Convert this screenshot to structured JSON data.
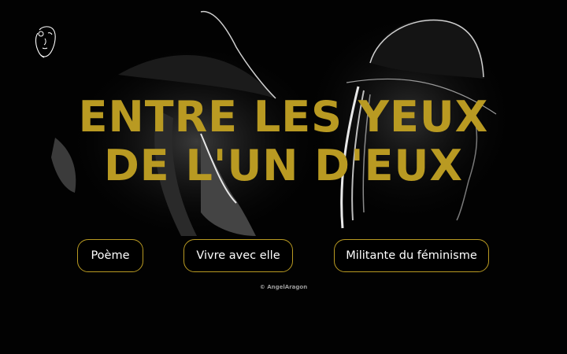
{
  "hero": {
    "title_line1": "ENTRE LES YEUX",
    "title_line2": "DE L'UN D'EUX"
  },
  "nav": {
    "buttons": [
      {
        "label": "Poème"
      },
      {
        "label": "Vivre avec elle"
      },
      {
        "label": "Militante du féminisme"
      }
    ]
  },
  "footer": {
    "copyright": "© AngelAragon"
  },
  "logo": {
    "icon": "face-line-art-icon"
  },
  "colors": {
    "accent": "#b99a22",
    "background": "#000000",
    "button_text": "#ffffff"
  }
}
